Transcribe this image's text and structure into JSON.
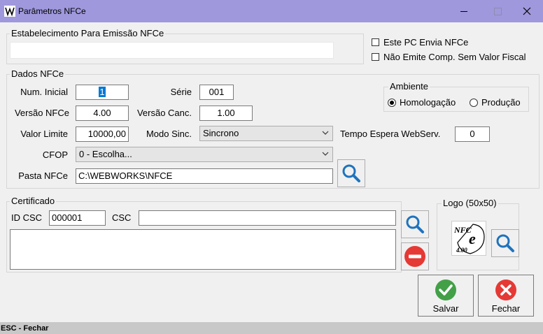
{
  "window": {
    "title": "Parâmetros NFCe",
    "icon": "app-logo-icon"
  },
  "estabelecimento": {
    "legend": "Estabelecimento Para Emissão NFCe",
    "value": "",
    "chk_envia_label": "Este PC Envia NFCe",
    "chk_nao_emite_label": "Não Emite Comp. Sem Valor Fiscal",
    "chk_envia_checked": false,
    "chk_nao_emite_checked": false
  },
  "dados": {
    "legend": "Dados NFCe",
    "num_inicial_label": "Num. Inicial",
    "num_inicial_value": "1",
    "serie_label": "Série",
    "serie_value": "001",
    "versao_label": "Versão NFCe",
    "versao_value": "4.00",
    "versao_canc_label": "Versão Canc.",
    "versao_canc_value": "1.00",
    "valor_limite_label": "Valor Limite",
    "valor_limite_value": "10000,00",
    "modo_sinc_label": "Modo Sinc.",
    "modo_sinc_value": "Sincrono",
    "tempo_espera_label": "Tempo Espera WebServ.",
    "tempo_espera_value": "0",
    "cfop_label": "CFOP",
    "cfop_value": "0 - Escolha...",
    "pasta_label": "Pasta NFCe",
    "pasta_value": "C:\\WEBWORKS\\NFCE"
  },
  "ambiente": {
    "legend": "Ambiente",
    "options": [
      "Homologação",
      "Produção"
    ],
    "selected": "Homologação"
  },
  "certificado": {
    "legend": "Certificado",
    "id_csc_label": "ID CSC",
    "id_csc_value": "000001",
    "csc_label": "CSC",
    "csc_value": "",
    "certificate_text": ""
  },
  "logo": {
    "legend": "Logo (50x50)",
    "logo_text": "NFC",
    "logo_version": "4.00"
  },
  "buttons": {
    "salvar": "Salvar",
    "fechar": "Fechar"
  },
  "status": {
    "text": "ESC - Fechar"
  },
  "colors": {
    "titlebar": "#9f98dc",
    "search_icon": "#1e73be",
    "remove_icon": "#e53935",
    "save_icon": "#43a047",
    "close_icon": "#e53935",
    "selection": "#0078d7"
  }
}
